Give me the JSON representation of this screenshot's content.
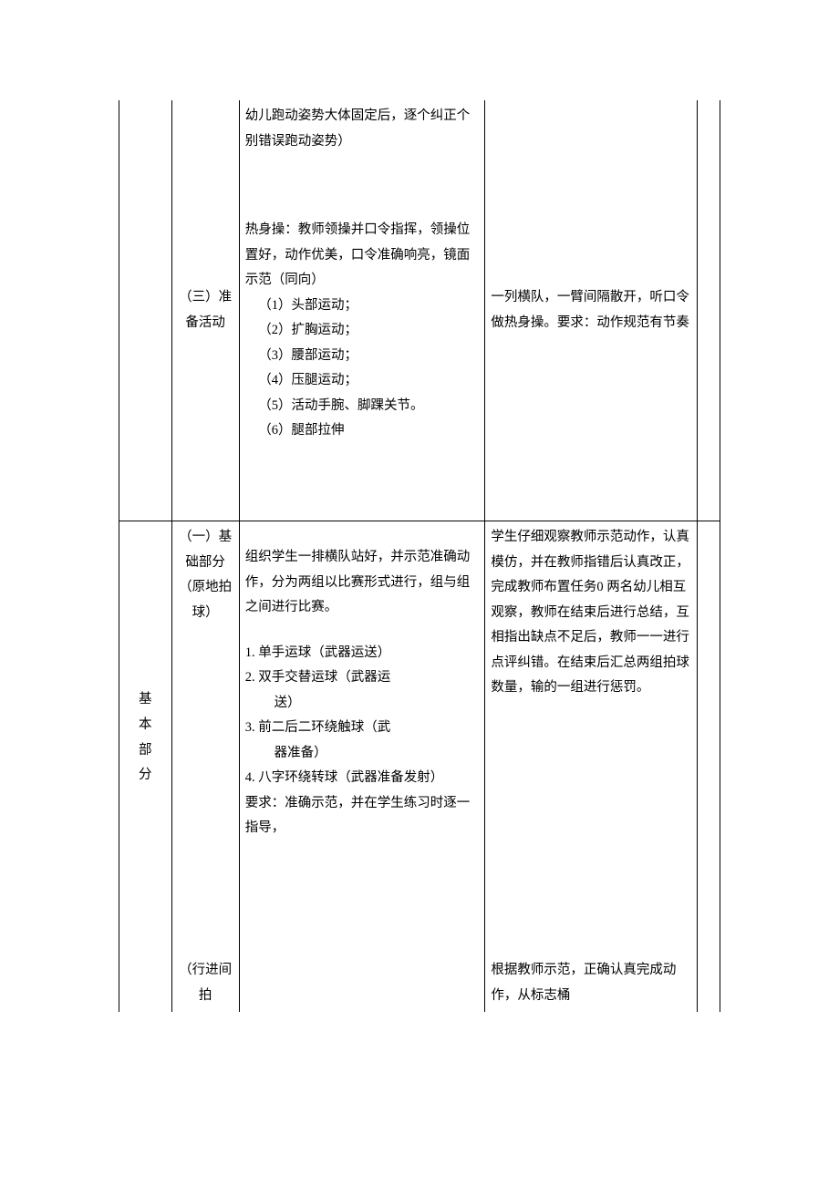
{
  "row1": {
    "c2": "（三）准备活动",
    "c3_top": "幼儿跑动姿势大体固定后，逐个纠正个别错误跑动姿势）",
    "c3_mid": "热身操：教师领操并口令指挥，领操位置好，动作优美，口令准确响亮，镜面示范（同向）",
    "c3_list": [
      "（1）头部运动；",
      "（2）扩胸运动；",
      "（3）腰部运动；",
      "（4）压腿运动；",
      "（5）活动手腕、脚踝关节。",
      "（6）腿部拉伸"
    ],
    "c4": "一列横队，一臂间隔散开，听口令做热身操。要求：动作规范有节奏"
  },
  "row2": {
    "c1_a": "基",
    "c1_b": "本",
    "c1_c": "部",
    "c1_d": "分",
    "c2": "（一）基础部分（原地拍球）",
    "c3_top": "组织学生一排横队站好，并示范准确动作，分为两组以比赛形式进行，组与组之间进行比赛。",
    "c3_list1": "1. 单手运球（武器运送）",
    "c3_list2a": "2. 双手交替运球（武器运",
    "c3_list2b": "送）",
    "c3_list3a": "3. 前二后二环绕触球（武",
    "c3_list3b": "器准备）",
    "c3_list4": "4. 八字环绕转球（武器准备发射）",
    "c3_req": "要求：准确示范，并在学生练习时逐一指导，",
    "c4": "学生仔细观察教师示范动作，认真模仿，并在教师指错后认真改正，完成教师布置任务0 两名幼儿相互观察，教师在结束后进行总结，互相指出缺点不足后，教师一一进行点评纠错。在结束后汇总两组拍球数量，输的一组进行惩罚。"
  },
  "row3": {
    "c2": "（行进间拍",
    "c4": "根据教师示范，正确认真完成动作，从标志桶"
  }
}
